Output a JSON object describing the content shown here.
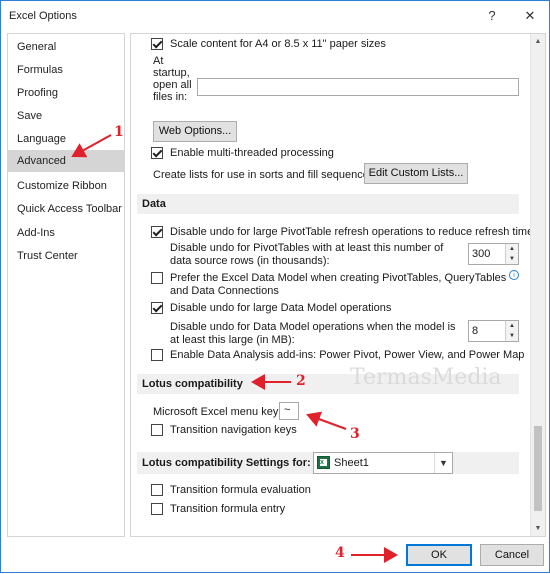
{
  "window": {
    "title": "Excel Options",
    "help_button": "?",
    "close_button": "✕"
  },
  "sidebar": {
    "items": [
      {
        "label": "General"
      },
      {
        "label": "Formulas"
      },
      {
        "label": "Proofing"
      },
      {
        "label": "Save"
      },
      {
        "label": "Language"
      },
      {
        "label": "Advanced"
      },
      {
        "label": "Customize Ribbon"
      },
      {
        "label": "Quick Access Toolbar"
      },
      {
        "label": "Add-Ins"
      },
      {
        "label": "Trust Center"
      }
    ],
    "selected": "Advanced"
  },
  "content": {
    "scale_content_label": "Scale content for A4 or 8.5 x 11\" paper sizes",
    "scale_content_checked": true,
    "startup_open_label": "At startup, open all files in:",
    "startup_open_value": "",
    "web_options_button": "Web Options...",
    "multi_thread_label": "Enable multi-threaded processing",
    "multi_thread_checked": true,
    "custom_lists_label": "Create lists for use in sorts and fill sequences:",
    "custom_lists_button": "Edit Custom Lists...",
    "data_section": {
      "header": "Data",
      "disable_undo_pivot_label": "Disable undo for large PivotTable refresh operations to reduce refresh time",
      "disable_undo_pivot_checked": true,
      "pivot_rows_label": "Disable undo for PivotTables with at least this number of data source rows (in thousands):",
      "pivot_rows_value": "300",
      "prefer_data_model_label": "Prefer the Excel Data Model when creating PivotTables, QueryTables and Data Connections",
      "prefer_data_model_checked": false,
      "disable_undo_model_label": "Disable undo for large Data Model operations",
      "disable_undo_model_checked": true,
      "model_size_label": "Disable undo for Data Model operations when the model is at least this large (in MB):",
      "model_size_value": "8",
      "analysis_addins_label": "Enable Data Analysis add-ins: Power Pivot, Power View, and Power Map",
      "analysis_addins_checked": false
    },
    "lotus_section": {
      "header": "Lotus compatibility",
      "menu_key_label": "Microsoft Excel menu key:",
      "menu_key_value": "~",
      "transition_nav_label": "Transition navigation keys",
      "transition_nav_checked": false
    },
    "lotus_settings_section": {
      "header": "Lotus compatibility Settings for:",
      "sheet_selected": "Sheet1",
      "transition_formula_eval_label": "Transition formula evaluation",
      "transition_formula_eval_checked": false,
      "transition_formula_entry_label": "Transition formula entry",
      "transition_formula_entry_checked": false
    }
  },
  "footer": {
    "ok_button": "OK",
    "cancel_button": "Cancel"
  },
  "annotations": {
    "step1": "1",
    "step2": "2",
    "step3": "3",
    "step4": "4",
    "color": "#e0202a"
  },
  "watermark": "TermasMedia",
  "colors": {
    "accent": "#0078d7",
    "selected_bg": "#d5d5d5",
    "section_bg": "#f0f0f0"
  }
}
